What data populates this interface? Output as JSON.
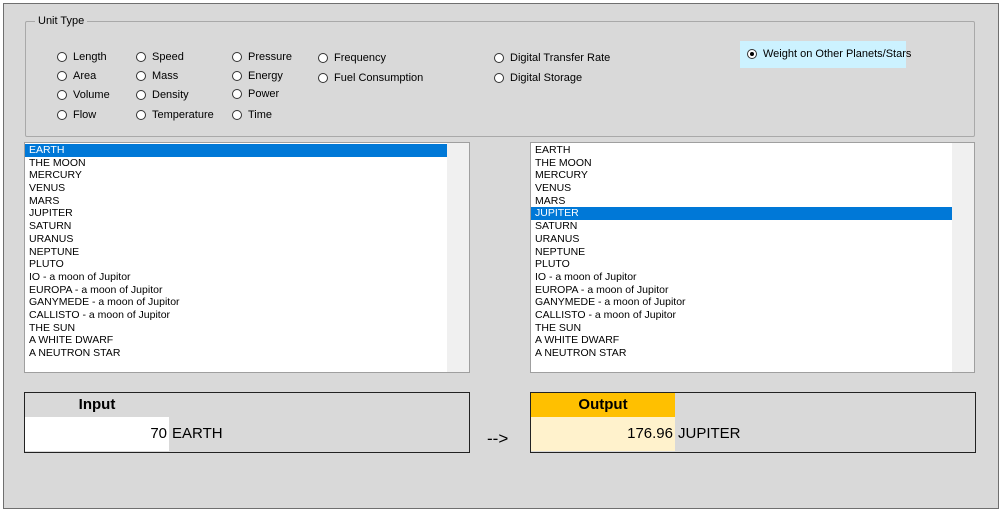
{
  "unit_type": {
    "legend": "Unit Type",
    "options": [
      {
        "label": "Length",
        "checked": false
      },
      {
        "label": "Area",
        "checked": false
      },
      {
        "label": "Volume",
        "checked": false
      },
      {
        "label": "Flow",
        "checked": false
      },
      {
        "label": "Speed",
        "checked": false
      },
      {
        "label": "Mass",
        "checked": false
      },
      {
        "label": "Density",
        "checked": false
      },
      {
        "label": "Temperature",
        "checked": false
      },
      {
        "label": "Pressure",
        "checked": false
      },
      {
        "label": "Energy",
        "checked": false
      },
      {
        "label": "Power",
        "checked": false
      },
      {
        "label": "Time",
        "checked": false
      },
      {
        "label": "Frequency",
        "checked": false
      },
      {
        "label": "Fuel Consumption",
        "checked": false
      },
      {
        "label": "Digital Transfer Rate",
        "checked": false
      },
      {
        "label": "Digital Storage",
        "checked": false
      },
      {
        "label": "Weight on Other Planets/Stars",
        "checked": true
      }
    ],
    "highlight_color": "#ccf2ff"
  },
  "from_list": {
    "items": [
      "EARTH",
      "THE MOON",
      "MERCURY",
      "VENUS",
      "MARS",
      "JUPITER",
      "SATURN",
      "URANUS",
      "NEPTUNE",
      "PLUTO",
      "IO - a moon of Jupitor",
      "EUROPA - a moon of Jupitor",
      "GANYMEDE - a moon of Jupitor",
      "CALLISTO - a moon of Jupitor",
      "THE SUN",
      "A WHITE DWARF",
      "A NEUTRON STAR"
    ],
    "selected": "EARTH"
  },
  "to_list": {
    "items": [
      "EARTH",
      "THE MOON",
      "MERCURY",
      "VENUS",
      "MARS",
      "JUPITER",
      "SATURN",
      "URANUS",
      "NEPTUNE",
      "PLUTO",
      "IO - a moon of Jupitor",
      "EUROPA - a moon of Jupitor",
      "GANYMEDE - a moon of Jupitor",
      "CALLISTO - a moon of Jupitor",
      "THE SUN",
      "A WHITE DWARF",
      "A NEUTRON STAR"
    ],
    "selected": "JUPITER"
  },
  "input": {
    "header": "Input",
    "value": "70",
    "unit": "EARTH",
    "header_color": "#d9d9d9",
    "value_bg": "#ffffff"
  },
  "output": {
    "header": "Output",
    "value": "176.96",
    "unit": "JUPITER",
    "header_color": "#ffc000",
    "value_bg": "#fff2cc"
  },
  "arrow_text": "-->",
  "colors": {
    "selection": "#0078d7",
    "panel_bg": "#d9d9d9"
  }
}
